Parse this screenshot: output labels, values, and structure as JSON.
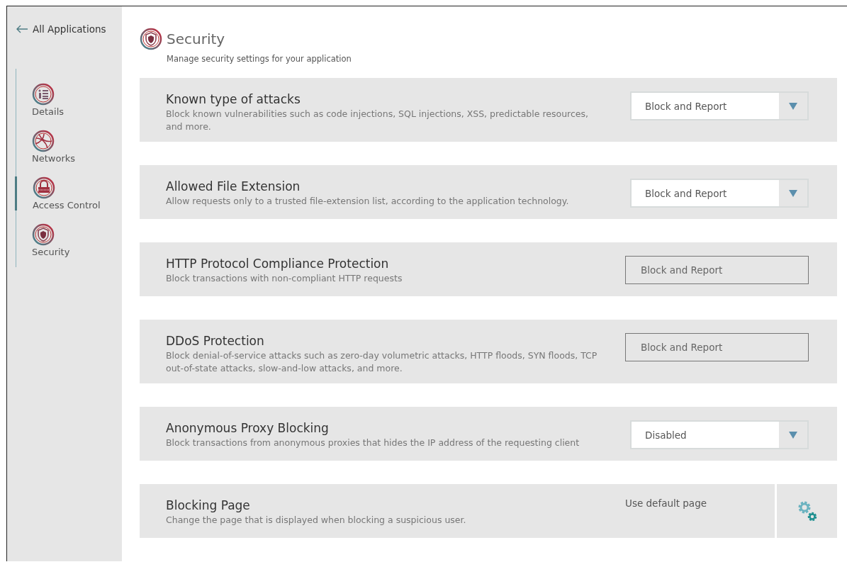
{
  "sidebar": {
    "back_link": "All Applications",
    "items": [
      {
        "label": "Details",
        "selected": false
      },
      {
        "label": "Networks",
        "selected": false
      },
      {
        "label": "Access Control",
        "selected": true
      },
      {
        "label": "Security",
        "selected": false
      }
    ]
  },
  "header": {
    "title": "Security",
    "subtitle": "Manage security settings for your application"
  },
  "settings": [
    {
      "title": "Known type of attacks",
      "description": "Block known vulnerabilities such as code injections, SQL injections, XSS, predictable resources, and more.",
      "kind": "dropdown",
      "value": "Block and Report"
    },
    {
      "title": "Allowed File Extension",
      "description": "Allow requests only to a trusted file-extension list, according to the application technology.",
      "kind": "dropdown",
      "value": "Block and Report"
    },
    {
      "title": "HTTP Protocol Compliance Protection",
      "description": "Block transactions with non-compliant HTTP requests",
      "kind": "readonly",
      "value": "Block and Report"
    },
    {
      "title": "DDoS Protection",
      "description": "Block denial-of-service attacks such as zero-day volumetric attacks, HTTP floods, SYN floods, TCP out-of-state attacks, slow-and-low attacks, and more.",
      "kind": "readonly",
      "value": "Block and Report"
    },
    {
      "title": "Anonymous Proxy Blocking",
      "description": "Block transactions from anonymous proxies that hides the IP address of the requesting client",
      "kind": "dropdown",
      "value": "Disabled"
    },
    {
      "title": "Blocking Page",
      "description": "Change the page that is displayed when blocking a suspicious user.",
      "kind": "settings",
      "value": "Use default page"
    }
  ]
}
